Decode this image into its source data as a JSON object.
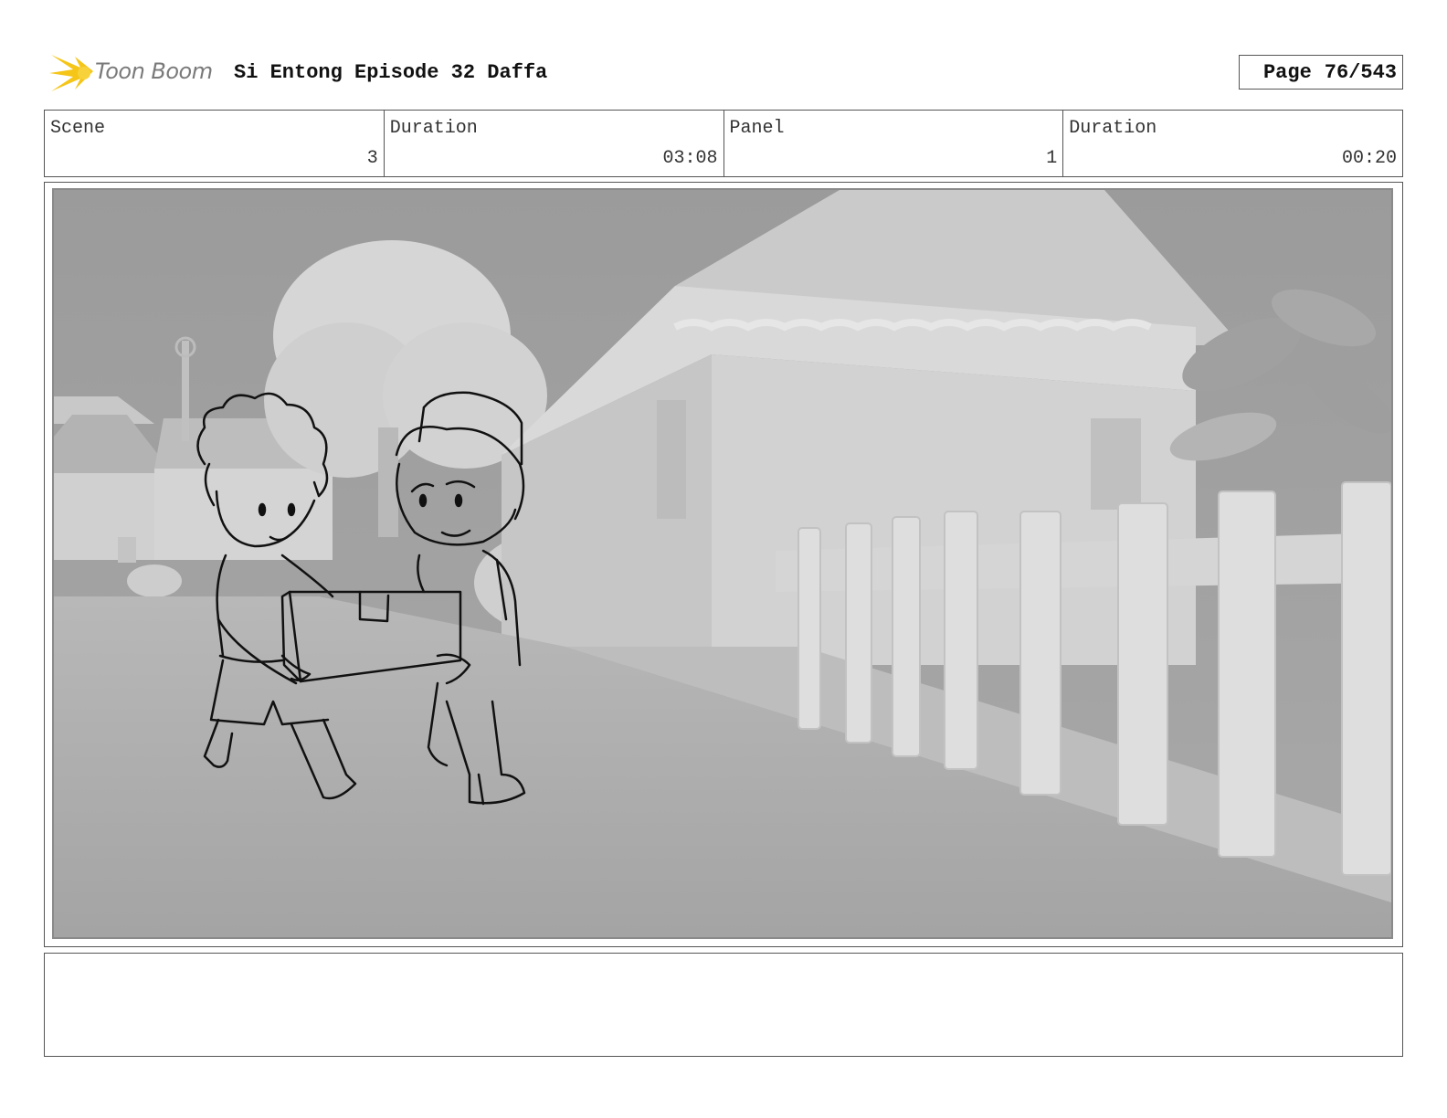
{
  "header": {
    "logo_text": "Toon Boom",
    "title": "Si Entong Episode 32 Daffa",
    "page_label": "Page",
    "page_value": "76/543"
  },
  "info": {
    "scene_label": "Scene",
    "scene_value": "3",
    "scene_duration_label": "Duration",
    "scene_duration_value": "03:08",
    "panel_label": "Panel",
    "panel_value": "1",
    "panel_duration_label": "Duration",
    "panel_duration_value": "00:20"
  },
  "notes": {
    "text": ""
  },
  "colors": {
    "logo_accent": "#f5c518",
    "frame_border": "#555555"
  }
}
